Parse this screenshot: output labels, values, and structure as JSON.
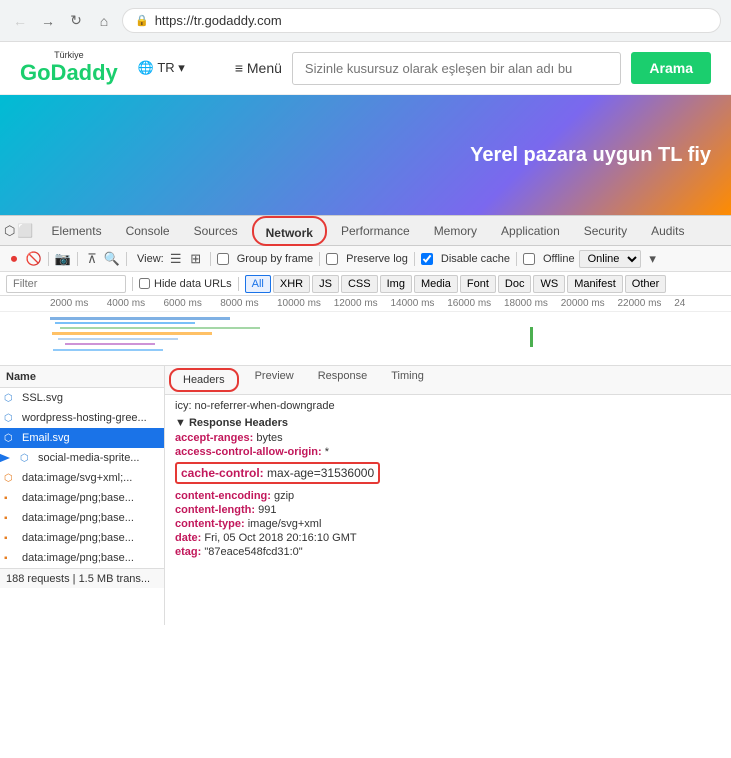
{
  "browser": {
    "url": "https://tr.godaddy.com",
    "back_btn": "←",
    "forward_btn": "→",
    "reload_btn": "↻",
    "home_btn": "⌂"
  },
  "site": {
    "logo": "GoDaddy",
    "logo_sub": "Türkiye",
    "lang": "🌐 TR ▾",
    "menu": "≡ Menü",
    "search_placeholder": "Sizinle kusursuz olarak eşleşen bir alan adı bu",
    "search_btn": "Arama",
    "hero_text": "Yerel pazara uygun TL fiy"
  },
  "devtools": {
    "tabs": [
      "Elements",
      "Console",
      "Sources",
      "Network",
      "Performance",
      "Memory",
      "Application",
      "Security",
      "Audits"
    ],
    "active_tab": "Network",
    "toolbar": {
      "view_label": "View:",
      "preserve_log_label": "Preserve log",
      "disable_cache_label": "Disable cache",
      "disable_cache_checked": true,
      "offline_label": "Offline",
      "online_label": "Online"
    },
    "filter": {
      "placeholder": "Filter",
      "hide_data_label": "Hide data URLs",
      "types": [
        "All",
        "XHR",
        "JS",
        "CSS",
        "Img",
        "Media",
        "Font",
        "Doc",
        "WS",
        "Manifest",
        "Other"
      ],
      "active_type": "All"
    },
    "timeline": {
      "labels": [
        "2000 ms",
        "4000 ms",
        "6000 ms",
        "8000 ms",
        "10000 ms",
        "12000 ms",
        "14000 ms",
        "16000 ms",
        "18000 ms",
        "20000 ms",
        "22000 ms",
        "24"
      ]
    },
    "file_list": {
      "column": "Name",
      "files": [
        {
          "name": "SSL.svg",
          "type": "svg",
          "selected": false
        },
        {
          "name": "wordpress-hosting-gree...",
          "type": "svg",
          "selected": false
        },
        {
          "name": "Email.svg",
          "type": "svg",
          "selected": true
        },
        {
          "name": "social-media-sprite...",
          "type": "svg",
          "selected": false
        },
        {
          "name": "data:image/svg+xml;...",
          "type": "xml",
          "selected": false
        },
        {
          "name": "data:image/png;base...",
          "type": "png",
          "selected": false
        },
        {
          "name": "data:image/png;base...",
          "type": "png",
          "selected": false
        },
        {
          "name": "data:image/png;base...",
          "type": "png",
          "selected": false
        },
        {
          "name": "data:image/png;base...",
          "type": "png",
          "selected": false
        }
      ],
      "status": "188 requests | 1.5 MB trans..."
    },
    "response_tabs": [
      "Headers",
      "Preview",
      "Response",
      "Timing"
    ],
    "active_response_tab": "Headers",
    "headers": {
      "policy_line": "icy: no-referrer-when-downgrade",
      "response_section": "Response Headers",
      "rows": [
        {
          "key": "accept-ranges:",
          "val": "bytes"
        },
        {
          "key": "access-control-allow-origin:",
          "val": "*"
        },
        {
          "key": "cache-control:",
          "val": "max-age=31536000",
          "highlighted": true
        },
        {
          "key": "content-encoding:",
          "val": "gzip"
        },
        {
          "key": "content-length:",
          "val": "991"
        },
        {
          "key": "content-type:",
          "val": "image/svg+xml"
        },
        {
          "key": "date:",
          "val": "Fri, 05 Oct 2018 20:16:10 GMT"
        },
        {
          "key": "etag:",
          "val": "\"87eace548fcd31:0\""
        }
      ]
    }
  }
}
